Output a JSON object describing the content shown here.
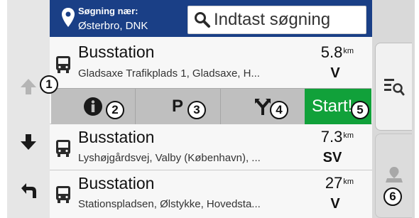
{
  "header": {
    "location_label": "Søgning nær:",
    "location_value": "Østerbro, DNK",
    "search_placeholder": "Indtast søgning"
  },
  "results": [
    {
      "name": "Busstation",
      "address": "Gladsaxe Trafikplads 1, Gladsaxe, H...",
      "distance_value": "5.8",
      "distance_unit": "km",
      "direction": "V"
    },
    {
      "name": "Busstation",
      "address": "Lyshøjgårdsvej, Valby (København), ...",
      "distance_value": "7.3",
      "distance_unit": "km",
      "direction": "SV"
    },
    {
      "name": "Busstation",
      "address": "Stationspladsen, Ølstykke, Hovedsta...",
      "distance_value": "27",
      "distance_unit": "km",
      "direction": "V"
    }
  ],
  "action_bar": {
    "info_icon": "info-icon",
    "parking_label": "P",
    "route_icon": "route-split-icon",
    "start_label": "Start!"
  },
  "left_rail": {
    "icons": [
      "up-arrow-icon",
      "down-arrow-icon",
      "back-icon"
    ]
  },
  "right_rail": {
    "icons": [
      "list-search-icon",
      "map-pin-icon"
    ]
  },
  "callouts": [
    "1",
    "2",
    "3",
    "4",
    "5",
    "6"
  ],
  "colors": {
    "header_bg": "#1a3f86",
    "start_green": "#11a13a",
    "action_bar_gray": "#bfbfbf"
  }
}
